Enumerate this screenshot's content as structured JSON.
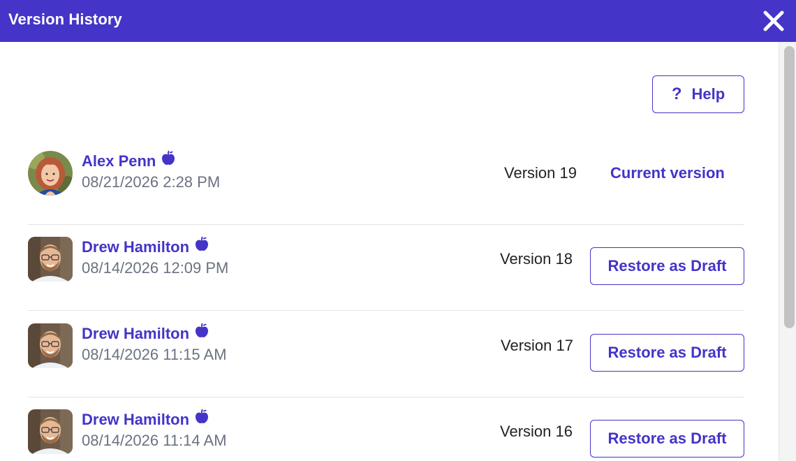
{
  "header": {
    "title": "Version History"
  },
  "help": {
    "label": "Help",
    "icon": "question-icon"
  },
  "colors": {
    "accent": "#4434c8",
    "muted": "#6b7280"
  },
  "versions": [
    {
      "author": "Alex Penn",
      "date": "08/21/2026 2:28 PM",
      "version": "Version 19",
      "status": "Current version",
      "avatar": "avatar-woman-red-hair"
    },
    {
      "author": "Drew Hamilton",
      "date": "08/14/2026 12:09 PM",
      "version": "Version 18",
      "action": "Restore as Draft",
      "avatar": "avatar-man-glasses"
    },
    {
      "author": "Drew Hamilton",
      "date": "08/14/2026 11:15 AM",
      "version": "Version 17",
      "action": "Restore as Draft",
      "avatar": "avatar-man-glasses"
    },
    {
      "author": "Drew Hamilton",
      "date": "08/14/2026 11:14 AM",
      "version": "Version 16",
      "action": "Restore as Draft",
      "avatar": "avatar-man-glasses"
    }
  ]
}
